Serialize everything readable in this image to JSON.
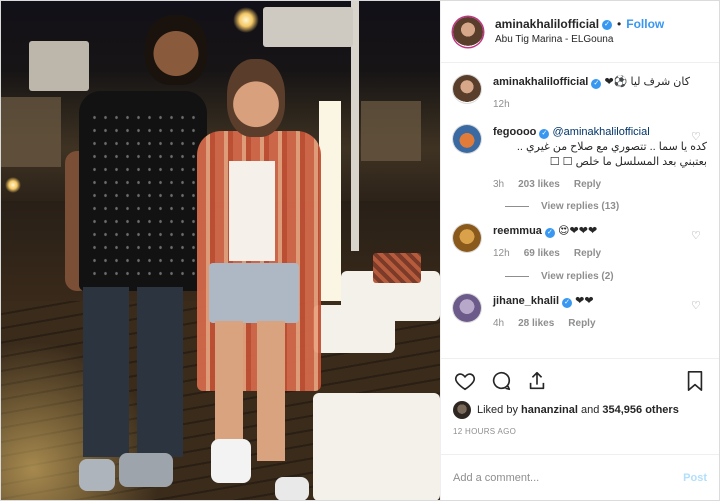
{
  "header": {
    "username": "aminakhalilofficial",
    "separator": "•",
    "follow_label": "Follow",
    "location": "Abu Tig Marina - ELGouna"
  },
  "caption": {
    "username": "aminakhalilofficial",
    "text": "كان شرف ليا ⚽❤",
    "age": "12h"
  },
  "comments": [
    {
      "username": "fegoooo",
      "mention": "@aminakhalilofficial",
      "text": "كده يا سما .. تتصوري مع صلاح من غيري .. بعتبني بعد المسلسل ما خلص ☐ ☐",
      "age": "3h",
      "likes": "203 likes",
      "reply": "Reply",
      "view_replies": "View replies (13)"
    },
    {
      "username": "reemmua",
      "text": "😍❤❤❤",
      "age": "12h",
      "likes": "69 likes",
      "reply": "Reply",
      "view_replies": "View replies (2)"
    },
    {
      "username": "jihane_khalil",
      "text": "❤❤",
      "age": "4h",
      "likes": "28 likes",
      "reply": "Reply"
    }
  ],
  "likes": {
    "prefix": "Liked by",
    "user": "hananzinal",
    "middle": "and",
    "others": "354,956 others"
  },
  "timestamp": "12 HOURS AGO",
  "add_comment": {
    "placeholder": "Add a comment...",
    "post_label": "Post"
  },
  "colors": {
    "accent": "#3897f0",
    "post_disabled": "#b2dffc",
    "muted": "#8e8e8e"
  },
  "icons": {
    "like": "heart-icon",
    "comment": "comment-icon",
    "share": "share-icon",
    "save": "bookmark-icon",
    "verified": "verified-badge-icon"
  }
}
